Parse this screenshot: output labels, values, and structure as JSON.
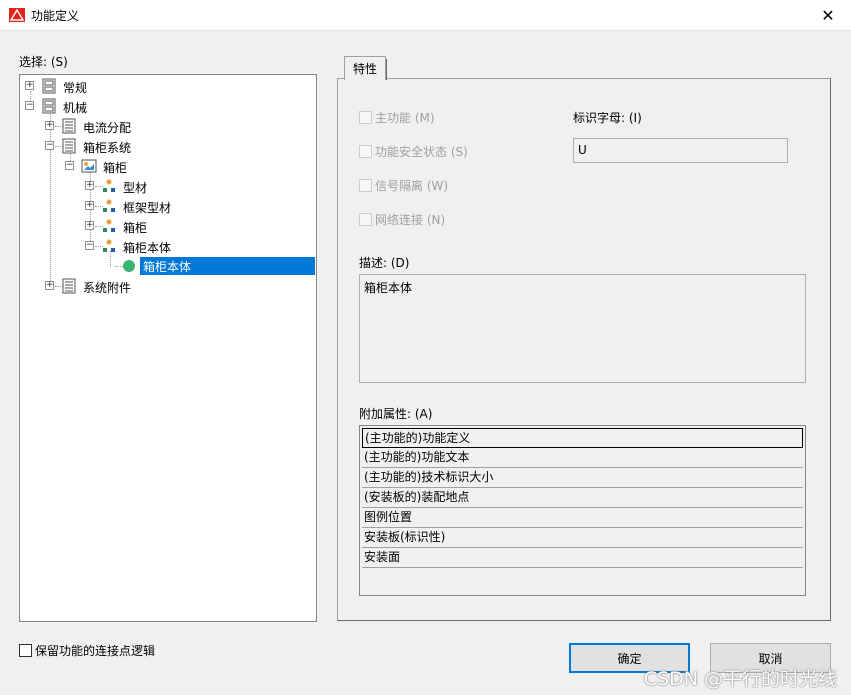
{
  "window": {
    "title": "功能定义"
  },
  "tree": {
    "label": "选择: (S)",
    "nodes": [
      {
        "label": "常规"
      },
      {
        "label": "机械"
      },
      {
        "label": "电流分配"
      },
      {
        "label": "箱柜系统"
      },
      {
        "label": "箱柜"
      },
      {
        "label": "型材"
      },
      {
        "label": "框架型材"
      },
      {
        "label": "箱柜"
      },
      {
        "label": "箱柜本体"
      },
      {
        "label": "箱柜本体"
      },
      {
        "label": "系统附件"
      }
    ]
  },
  "tab": {
    "label": "特性"
  },
  "properties": {
    "checkboxes": [
      "主功能 (M)",
      "功能安全状态 (S)",
      "信号隔离 (W)",
      "网络连接 (N)"
    ],
    "id_letter_label": "标识字母: (I)",
    "id_letter_value": "U",
    "description_label": "描述: (D)",
    "description_value": "箱柜本体",
    "extra_label": "附加属性: (A)",
    "extra_rows": [
      "(主功能的)功能定义",
      "(主功能的)功能文本",
      "(主功能的)技术标识大小",
      "(安装板的)装配地点",
      "图例位置",
      "安装板(标识性)",
      "安装面"
    ]
  },
  "footer": {
    "keep_logic_label": "保留功能的连接点逻辑",
    "ok": "确定",
    "cancel": "取消"
  },
  "watermark": "CSDN @平行的时光线"
}
